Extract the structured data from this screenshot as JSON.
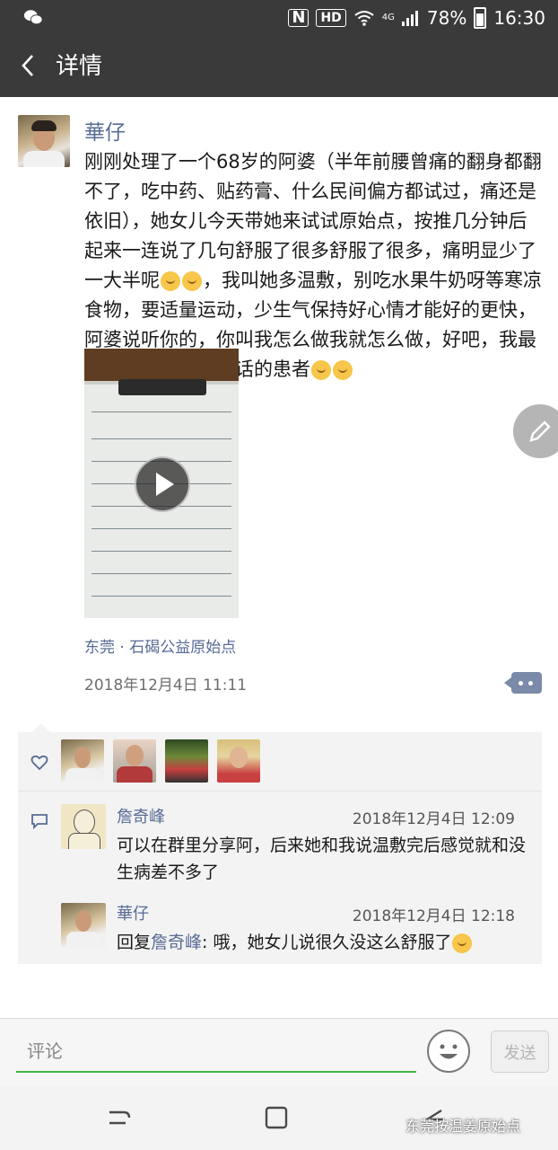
{
  "status_bar": {
    "signal_label": "4G",
    "battery": "78%",
    "time": "16:30",
    "hd": "HD",
    "nfc": "N"
  },
  "header": {
    "title": "详情"
  },
  "post": {
    "author": "華仔",
    "text": "刚刚处理了一个68岁的阿婆（半年前腰曾痛的翻身都翻不了，吃中药、贴药膏、什么民间偏方都试过，痛还是依旧），她女儿今天带她来试试原始点，按推几分钟后起来一连说了几句舒服了很多舒服了很多，痛明显少了一大半呢",
    "text_part2": "，我叫她多温敷，别吃水果牛奶呀等寒凉食物，要适量运动，少生气保持好心情才能好的更快，阿婆说听你的，你叫我怎么做我就怎么做，好吧，我最喜欢的就是这么听话的患者",
    "location": "东莞 · 石碣公益原始点",
    "timestamp": "2018年12月4日 11:11"
  },
  "comments": [
    {
      "name": "詹奇峰",
      "time": "2018年12月4日 12:09",
      "text": "可以在群里分享阿，后来她和我说温敷完后感觉就和没生病差不多了"
    },
    {
      "name": "華仔",
      "time": "2018年12月4日 12:18",
      "reply_prefix": "回复",
      "reply_to": "詹奇峰",
      "text": ": 哦，她女儿说很久没这么舒服了"
    }
  ],
  "input": {
    "placeholder": "评论",
    "send_label": "发送"
  },
  "watermark": "东莞按温姜原始点"
}
